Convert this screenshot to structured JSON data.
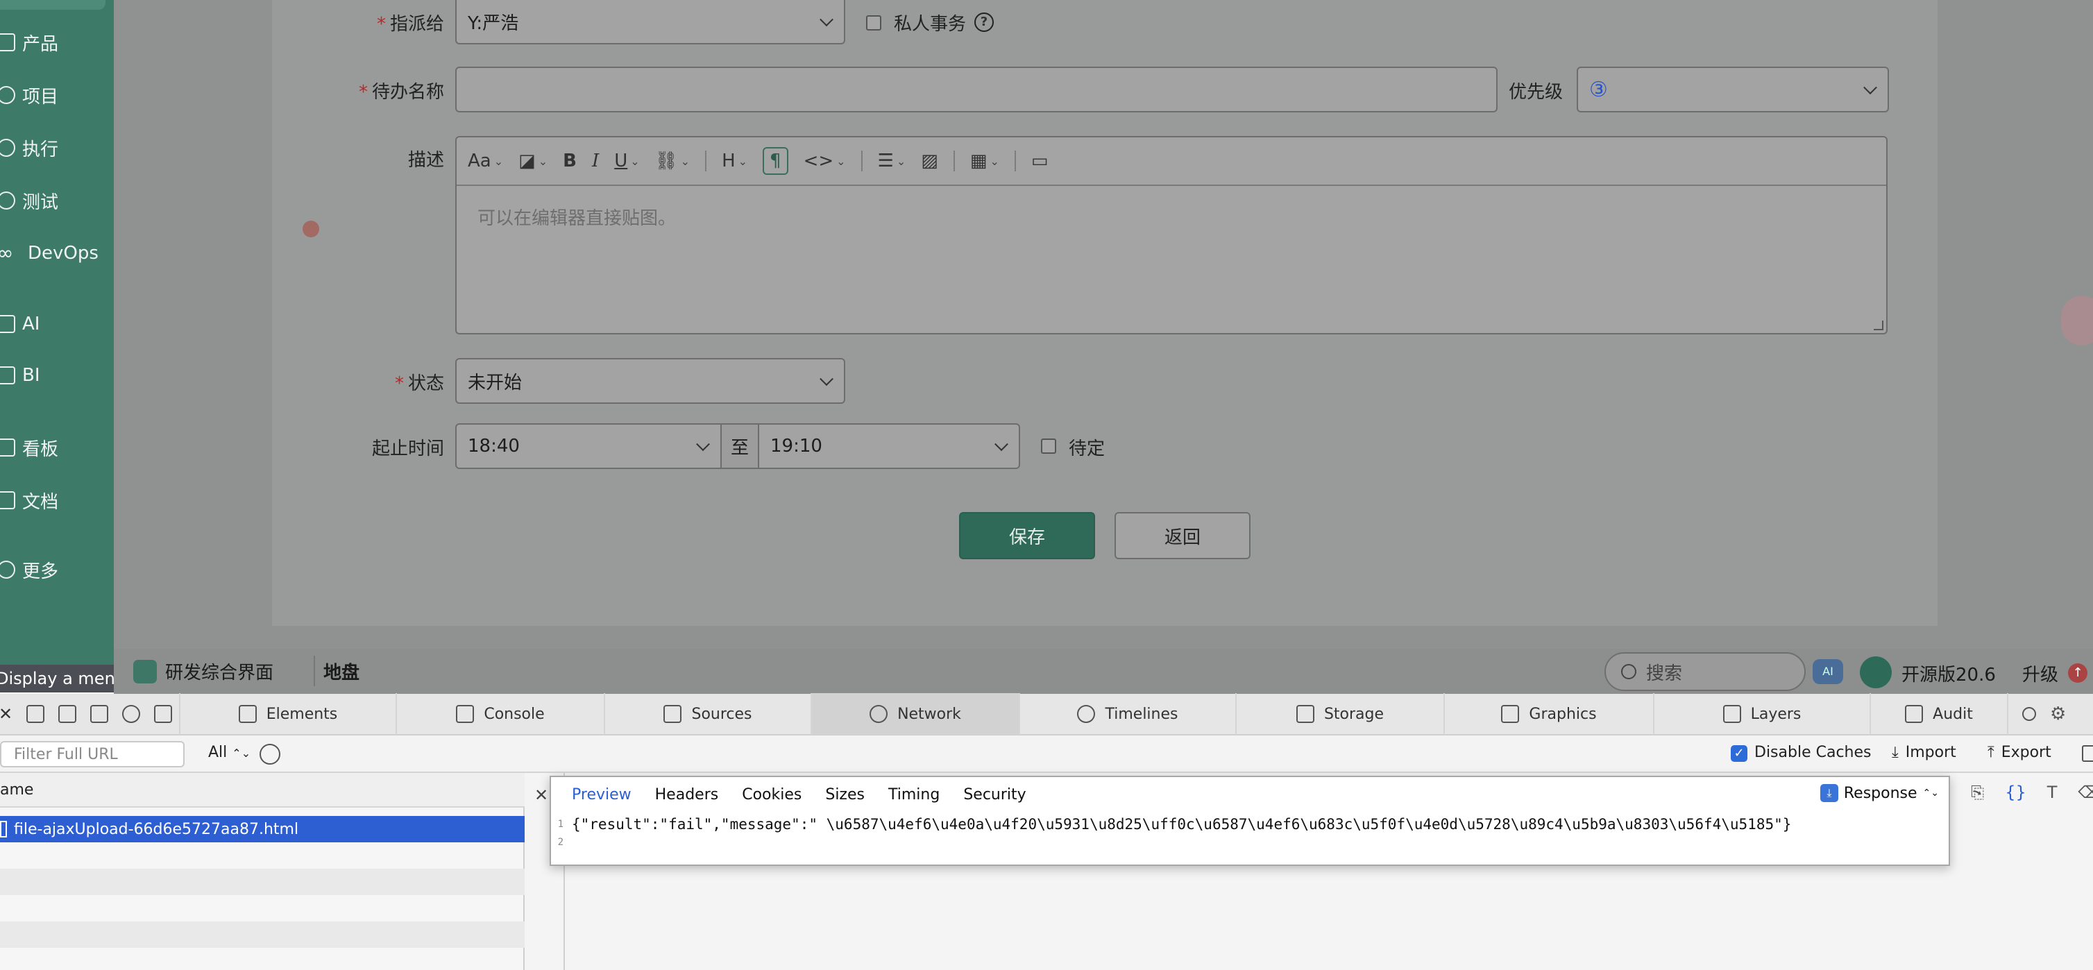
{
  "sidebar": {
    "items": [
      {
        "label": "产品",
        "icon": "product-icon"
      },
      {
        "label": "项目",
        "icon": "rocket-icon"
      },
      {
        "label": "执行",
        "icon": "execution-icon"
      },
      {
        "label": "测试",
        "icon": "test-icon"
      },
      {
        "label": "DevOps",
        "icon": "infinity-icon"
      },
      {
        "label": "AI",
        "icon": "robot-icon"
      },
      {
        "label": "BI",
        "icon": "chart-icon"
      },
      {
        "label": "看板",
        "icon": "kanban-icon"
      },
      {
        "label": "文档",
        "icon": "document-icon"
      },
      {
        "label": "更多",
        "icon": "more-icon"
      }
    ],
    "tooltip": "Display a menu"
  },
  "form": {
    "assign": {
      "label": "指派给",
      "value": "Y:严浩"
    },
    "private": {
      "label": "私人事务",
      "help": "?"
    },
    "todo_name": {
      "label": "待办名称",
      "value": ""
    },
    "priority": {
      "label": "优先级",
      "value": "③"
    },
    "description": {
      "label": "描述",
      "placeholder": "可以在编辑器直接贴图。"
    },
    "status": {
      "label": "状态",
      "value": "未开始"
    },
    "time": {
      "label": "起止时间",
      "start": "18:40",
      "to": "至",
      "end": "19:10",
      "pending_label": "待定"
    },
    "save": "保存",
    "back": "返回"
  },
  "editor_toolbar": {
    "font_size": "Aa",
    "bold": "B",
    "italic": "I",
    "underline": "U",
    "heading": "H",
    "paragraph": "¶",
    "code": "<>"
  },
  "appbar": {
    "tab1": "研发综合界面",
    "tab2": "地盘",
    "search_placeholder": "搜索",
    "version": "开源版20.6",
    "upgrade": "升级"
  },
  "devtools": {
    "tabs": [
      "Elements",
      "Console",
      "Sources",
      "Network",
      "Timelines",
      "Storage",
      "Graphics",
      "Layers",
      "Audit"
    ],
    "selected_tab": "Network",
    "filter_placeholder": "Filter Full URL",
    "type_filter": "All",
    "disable_caches": "Disable Caches",
    "import": "Import",
    "export": "Export",
    "list_header": "ame",
    "request_name": "file-ajaxUpload-66d6e5727aa87.html",
    "preview_tabs": [
      "Preview",
      "Headers",
      "Cookies",
      "Sizes",
      "Timing",
      "Security"
    ],
    "response_mode": "Response",
    "code_line1": "{\"result\":\"fail\",\"message\":\" \\u6587\\u4ef6\\u4e0a\\u4f20\\u5931\\u8d25\\uff0c\\u6587\\u4ef6\\u683c\\u5f0f\\u4e0d\\u5728\\u89c4\\u5b9a\\u8303\\u56f4\\u5185\"}",
    "line_numbers": [
      "1",
      "2"
    ]
  }
}
